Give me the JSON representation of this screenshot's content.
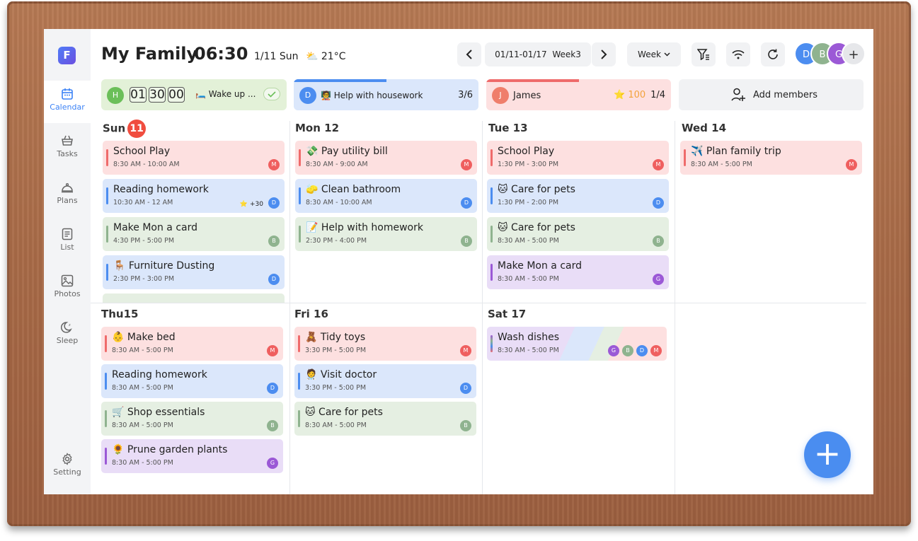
{
  "app": {
    "logo": "F",
    "title": "My Family",
    "time": "06:30",
    "date": "1/11 Sun",
    "weather": "21°C"
  },
  "sidebar": [
    {
      "label": "Calendar",
      "icon": "calendar-icon",
      "active": true
    },
    {
      "label": "Tasks",
      "icon": "basket-icon"
    },
    {
      "label": "Plans",
      "icon": "cloche-icon"
    },
    {
      "label": "List",
      "icon": "list-icon"
    },
    {
      "label": "Photos",
      "icon": "photo-icon"
    },
    {
      "label": "Sleep",
      "icon": "moon-icon"
    },
    {
      "label": "Setting",
      "icon": "gear-icon"
    }
  ],
  "toolbar": {
    "range": "01/11-01/17",
    "week": "Week3",
    "view": "Week"
  },
  "members": [
    {
      "initial": "D",
      "color": "#4c8df0"
    },
    {
      "initial": "B",
      "color": "#8fb38f"
    },
    {
      "initial": "G",
      "color": "#9b59d6"
    },
    {
      "initial": "+",
      "color": "#e6e7ea"
    }
  ],
  "status": {
    "routine": {
      "avatar": "H",
      "digits": [
        "01",
        "30",
        "00"
      ],
      "label": "🛏️ Wake up ..."
    },
    "chore": {
      "avatar": "D",
      "label": "🧑‍🏫 Help with housework",
      "count": "3/6"
    },
    "member": {
      "avatar": "J",
      "label": "James",
      "stars": "100",
      "count": "1/4"
    },
    "add": "Add members"
  },
  "days": [
    {
      "label": "Sun",
      "badge": "11",
      "events": [
        {
          "title": "School Play",
          "time": "8:30 AM - 10:00 AM",
          "who": "M",
          "color": "red"
        },
        {
          "title": "Reading homework",
          "time": "10:30 AM - 12 AM",
          "who": "D",
          "color": "blue",
          "bonus": "+30"
        },
        {
          "title": "Make Mon a card",
          "time": "4:30 PM - 5:00 PM",
          "who": "B",
          "color": "green"
        },
        {
          "title": "🪑 Furniture Dusting",
          "time": "2:30 PM - 3:00 PM",
          "who": "D",
          "color": "blue"
        }
      ]
    },
    {
      "label": "Mon 12",
      "events": [
        {
          "title": "💸 Pay utility bill",
          "time": "8:30 AM - 9:00 AM",
          "who": "M",
          "color": "red"
        },
        {
          "title": "🧽 Clean bathroom",
          "time": "8:30 AM - 10:00 AM",
          "who": "D",
          "color": "blue"
        },
        {
          "title": "📝 Help with homework",
          "time": "2:30 PM - 4:00 PM",
          "who": "B",
          "color": "green"
        }
      ]
    },
    {
      "label": "Tue 13",
      "events": [
        {
          "title": "School Play",
          "time": "1:30 PM - 3:00 PM",
          "who": "M",
          "color": "red"
        },
        {
          "title": "🐱 Care for pets",
          "time": "1:30 PM - 2:00 PM",
          "who": "D",
          "color": "blue"
        },
        {
          "title": "🐱 Care for pets",
          "time": "8:30 AM - 5:00 PM",
          "who": "B",
          "color": "green"
        },
        {
          "title": "Make Mon a card",
          "time": "8:30 AM - 5:00 PM",
          "who": "G",
          "color": "purple"
        }
      ]
    },
    {
      "label": "Wed 14",
      "events": [
        {
          "title": "✈️ Plan family trip",
          "time": "8:30 AM - 5:00 PM",
          "who": "M",
          "color": "red"
        }
      ]
    },
    {
      "label": "Thu15",
      "events": [
        {
          "title": "👶 Make bed",
          "time": "8:30 AM - 5:00 PM",
          "who": "M",
          "color": "red"
        },
        {
          "title": "Reading homework",
          "time": "8:30 AM - 5:00 PM",
          "who": "D",
          "color": "blue"
        },
        {
          "title": "🛒 Shop essentials",
          "time": "8:30 AM - 5:00 PM",
          "who": "B",
          "color": "green"
        },
        {
          "title": "🌻 Prune garden plants",
          "time": "8:30 AM - 5:00 PM",
          "who": "G",
          "color": "purple"
        }
      ]
    },
    {
      "label": "Fri 16",
      "events": [
        {
          "title": "🧸 Tidy toys",
          "time": "3:30 PM - 5:00 PM",
          "who": "M",
          "color": "red"
        },
        {
          "title": "🧑‍⚕️ Visit doctor",
          "time": "3:30 PM - 5:00 PM",
          "who": "D",
          "color": "blue"
        },
        {
          "title": "🐱 Care for pets",
          "time": "8:30 AM - 5:00 PM",
          "who": "B",
          "color": "green"
        }
      ]
    },
    {
      "label": "Sat 17",
      "events": [
        {
          "title": "Wash dishes",
          "time": "8:30 AM - 5:00 PM",
          "who": [
            "G",
            "B",
            "D",
            "M"
          ],
          "color": "multi"
        }
      ]
    }
  ],
  "colors": {
    "M": "#ef5f5f",
    "D": "#4c8df0",
    "B": "#8fb38f",
    "G": "#9b59d6",
    "red": "#ef6b6b",
    "blue": "#4c8df0",
    "green": "#8fb38f",
    "purple": "#9b59d6"
  }
}
